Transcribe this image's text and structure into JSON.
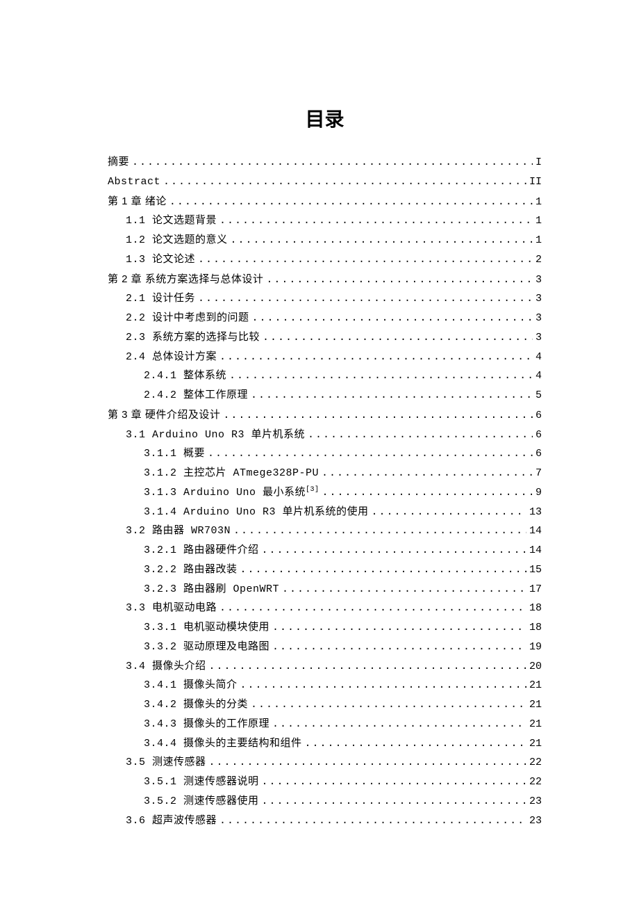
{
  "title": "目录",
  "entries": [
    {
      "level": 0,
      "chapter": false,
      "label": "摘要",
      "page": "I"
    },
    {
      "level": 0,
      "chapter": false,
      "label": "Abstract",
      "page": "II"
    },
    {
      "level": 0,
      "chapter": true,
      "label": "第 1 章  绪论",
      "page": "1"
    },
    {
      "level": 1,
      "chapter": false,
      "label": "1.1 论文选题背景",
      "page": "1"
    },
    {
      "level": 1,
      "chapter": false,
      "label": "1.2 论文选题的意义",
      "page": "1"
    },
    {
      "level": 1,
      "chapter": false,
      "label": "1.3 论文论述",
      "page": "2"
    },
    {
      "level": 0,
      "chapter": true,
      "label": "第 2 章  系统方案选择与总体设计",
      "page": "3"
    },
    {
      "level": 1,
      "chapter": false,
      "label": "2.1 设计任务",
      "page": "3"
    },
    {
      "level": 1,
      "chapter": false,
      "label": "2.2 设计中考虑到的问题",
      "page": "3"
    },
    {
      "level": 1,
      "chapter": false,
      "label": "2.3 系统方案的选择与比较",
      "page": "3"
    },
    {
      "level": 1,
      "chapter": false,
      "label": "2.4 总体设计方案",
      "page": "4"
    },
    {
      "level": 2,
      "chapter": false,
      "label": "2.4.1 整体系统",
      "page": "4"
    },
    {
      "level": 2,
      "chapter": false,
      "label": "2.4.2 整体工作原理",
      "page": "5"
    },
    {
      "level": 0,
      "chapter": true,
      "label": "第 3 章  硬件介绍及设计",
      "page": "6"
    },
    {
      "level": 1,
      "chapter": false,
      "label": "3.1  Arduino Uno R3 单片机系统",
      "page": "6"
    },
    {
      "level": 2,
      "chapter": false,
      "label": "3.1.1 概要",
      "page": "6"
    },
    {
      "level": 2,
      "chapter": false,
      "label": "3.1.2 主控芯片 ATmege328P-PU",
      "page": "7"
    },
    {
      "level": 2,
      "chapter": false,
      "label": "3.1.3  Arduino Uno 最小系统",
      "sup": "[3]",
      "page": "9"
    },
    {
      "level": 2,
      "chapter": false,
      "label": "3.1.4  Arduino Uno R3 单片机系统的使用",
      "page": "13"
    },
    {
      "level": 1,
      "chapter": false,
      "label": "3.2 路由器 WR703N",
      "page": "14"
    },
    {
      "level": 2,
      "chapter": false,
      "label": "3.2.1 路由器硬件介绍",
      "page": "14"
    },
    {
      "level": 2,
      "chapter": false,
      "label": "3.2.2 路由器改装",
      "page": "15"
    },
    {
      "level": 2,
      "chapter": false,
      "label": "3.2.3 路由器刷 OpenWRT",
      "page": "17"
    },
    {
      "level": 1,
      "chapter": false,
      "label": "3.3 电机驱动电路",
      "page": "18"
    },
    {
      "level": 2,
      "chapter": false,
      "label": "3.3.1 电机驱动模块使用",
      "page": "18"
    },
    {
      "level": 2,
      "chapter": false,
      "label": "3.3.2 驱动原理及电路图",
      "page": "19"
    },
    {
      "level": 1,
      "chapter": false,
      "label": "3.4 摄像头介绍",
      "page": "20"
    },
    {
      "level": 2,
      "chapter": false,
      "label": "3.4.1 摄像头简介",
      "page": "21"
    },
    {
      "level": 2,
      "chapter": false,
      "label": "3.4.2 摄像头的分类",
      "page": "21"
    },
    {
      "level": 2,
      "chapter": false,
      "label": "3.4.3 摄像头的工作原理",
      "page": "21"
    },
    {
      "level": 2,
      "chapter": false,
      "label": "3.4.4 摄像头的主要结构和组件",
      "page": "21"
    },
    {
      "level": 1,
      "chapter": false,
      "label": "3.5 测速传感器",
      "page": "22"
    },
    {
      "level": 2,
      "chapter": false,
      "label": "3.5.1 测速传感器说明",
      "page": "22"
    },
    {
      "level": 2,
      "chapter": false,
      "label": "3.5.2 测速传感器使用",
      "page": "23"
    },
    {
      "level": 1,
      "chapter": false,
      "label": "3.6 超声波传感器",
      "page": "23"
    }
  ]
}
